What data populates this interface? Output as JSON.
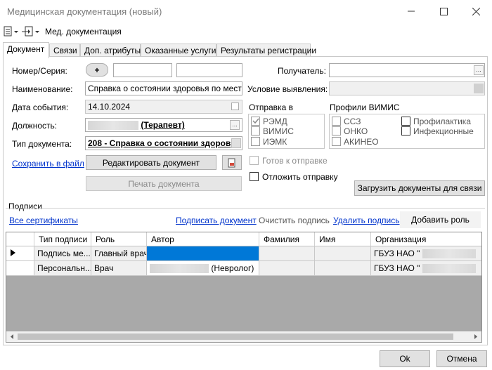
{
  "window": {
    "title": "Медицинская документация (новый)"
  },
  "toolbar": {
    "label": "Мед. документация"
  },
  "tabs": [
    {
      "label": "Документ",
      "active": true
    },
    {
      "label": "Связи"
    },
    {
      "label": "Доп. атрибуты"
    },
    {
      "label": "Оказанные услуги"
    },
    {
      "label": "Результаты регистрации"
    }
  ],
  "form": {
    "number_label": "Номер/Серия:",
    "add_btn": "+",
    "name_label": "Наименование:",
    "name_value": "Справка о состоянии здоровья по месту тр",
    "date_label": "Дата события:",
    "date_value": "14.10.2024",
    "position_label": "Должность:",
    "position_value": "(Терапевт)",
    "doctype_label": "Тип документа:",
    "doctype_value": "208 - Справка о состоянии здоров",
    "save_link": "Сохранить в файл",
    "edit_btn": "Редактировать документ",
    "print_btn": "Печать документа",
    "recipient_label": "Получатель:",
    "condition_label": "Условие выявления:"
  },
  "send": {
    "title": "Отправка в",
    "items": [
      {
        "label": "РЭМД",
        "checked": true
      },
      {
        "label": "ВИМИС",
        "checked": false
      },
      {
        "label": "ИЭМК",
        "checked": false
      }
    ]
  },
  "vimis": {
    "title": "Профили ВИМИС",
    "col1": [
      "ССЗ",
      "ОНКО",
      "АКИНЕО"
    ],
    "col2": [
      "Профилактика",
      "Инфекционные"
    ]
  },
  "ready_label": "Готов к отправке",
  "defer_label": "Отложить отправку",
  "load_btn": "Загрузить документы для связи",
  "signatures": {
    "title": "Подписи",
    "all_certs": "Все сертификаты",
    "sign_doc": "Подписать документ",
    "clear_sign": "Очистить подпись",
    "delete_sign": "Удалить подпись",
    "add_role": "Добавить роль",
    "columns": [
      "Тип подписи",
      "Роль",
      "Автор",
      "Фамилия",
      "Имя",
      "Организация"
    ],
    "rows": [
      {
        "type": "Подпись ме...",
        "role": "Главный врач",
        "author": "",
        "org": "ГБУЗ НАО \""
      },
      {
        "type": "Персональн...",
        "role": "Врач",
        "author": "(Невролог)",
        "org": "ГБУЗ НАО \""
      }
    ]
  },
  "footer": {
    "ok": "Ok",
    "cancel": "Отмена"
  }
}
